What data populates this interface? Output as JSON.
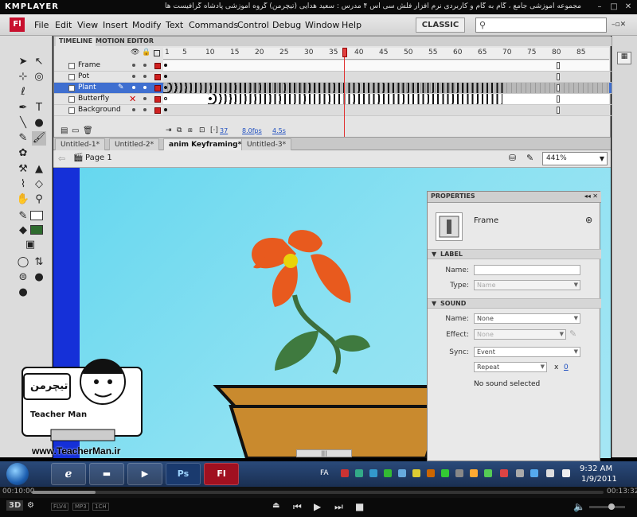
{
  "player": {
    "logo": "KMPLAYER",
    "caption": "مجموعه آموزشی جامع ، گام به گام و کاربردی نرم افزار فلش سی اس ۴ مدرس : سعید هدایی (تیچرمن) گروه آموزشی پادشاه گرافیست ها",
    "time_current": "00:10:00",
    "time_total": "00:13:32",
    "badges": [
      "FLV4",
      "MP3",
      "1CH"
    ],
    "label_3d": "3D"
  },
  "app": {
    "logo": "Fl",
    "menu": [
      "File",
      "Edit",
      "View",
      "Insert",
      "Modify",
      "Text",
      "Commands",
      "Control",
      "Debug",
      "Window",
      "Help"
    ],
    "workspace": "CLASSIC",
    "search_placeholder": ""
  },
  "timeline": {
    "tabs": [
      "TIMELINE",
      "MOTION EDITOR"
    ],
    "ruler": [
      "1",
      "5",
      "10",
      "15",
      "20",
      "25",
      "30",
      "35",
      "40",
      "45",
      "50",
      "55",
      "60",
      "65",
      "70",
      "75",
      "80",
      "85"
    ],
    "layers": [
      {
        "name": "Frame"
      },
      {
        "name": "Pot"
      },
      {
        "name": "Plant",
        "selected": true
      },
      {
        "name": "Butterfly"
      },
      {
        "name": "Background"
      }
    ],
    "current_frame": "37",
    "fps": "8.0fps",
    "time": "4.5s"
  },
  "documents": {
    "tabs": [
      "Untitled-1*",
      "Untitled-2*",
      "anim Keyframing*",
      "Untitled-3*"
    ],
    "active": 2
  },
  "editbar": {
    "scene": "Page 1",
    "zoom": "441%"
  },
  "properties": {
    "tab": "PROPERTIES",
    "type_label": "Frame",
    "label_section": "LABEL",
    "name_label": "Name:",
    "name_value": "",
    "type_field_label": "Type:",
    "type_value": "Name",
    "sound_section": "SOUND",
    "sound_name_label": "Name:",
    "sound_name_value": "None",
    "effect_label": "Effect:",
    "effect_value": "None",
    "sync_label": "Sync:",
    "sync_value": "Event",
    "repeat_value": "Repeat",
    "repeat_times": "x",
    "repeat_count": "0",
    "no_sound": "No sound selected"
  },
  "watermark": {
    "url": "www.TeacherMan.ir",
    "name": "Teacher Man",
    "persian_logo": "تیچرمن"
  },
  "taskbar": {
    "apps": [
      "Ps",
      "Fl"
    ],
    "lang": "FA",
    "time": "9:32 AM",
    "date": "1/9/2011"
  }
}
